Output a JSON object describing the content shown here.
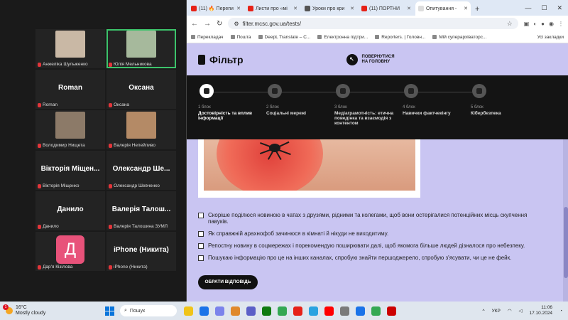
{
  "zoom": {
    "participants": [
      {
        "name": "Анжеліка Шульженко",
        "big": "",
        "photo": true,
        "photo_color": "#c9b8a5"
      },
      {
        "name": "Юлія Мельникова",
        "big": "",
        "photo": true,
        "photo_color": "#a6b99c",
        "active": true
      },
      {
        "name": "Roman",
        "big": "Roman"
      },
      {
        "name": "Оксана",
        "big": "Оксана"
      },
      {
        "name": "Володимир Нищета",
        "big": "",
        "photo": true,
        "photo_color": "#8c7a68"
      },
      {
        "name": "Валерія Непейпиво",
        "big": "",
        "photo": true,
        "photo_color": "#b48a66"
      },
      {
        "name": "Вікторія Міщенко",
        "big": "Вікторія Міщен..."
      },
      {
        "name": "Олександр Шевченко",
        "big": "Олександр Ше..."
      },
      {
        "name": "Данило",
        "big": "Данило"
      },
      {
        "name": "Валерія Талошина ЗУМЛ",
        "big": "Валерія Талош..."
      },
      {
        "name": "Дар'я Кізілова",
        "big": "",
        "avatar": "Д"
      },
      {
        "name": "iPhone (Никита)",
        "big": "iPhone (Никита)"
      }
    ]
  },
  "browser": {
    "tabs": [
      {
        "label": "(11) 🔥 Перепи",
        "color": "#e62117"
      },
      {
        "label": "Листи про «мі",
        "color": "#e62117"
      },
      {
        "label": "Уроки про кри",
        "color": "#555"
      },
      {
        "label": "(11) ПОРТНИ",
        "color": "#e62117"
      },
      {
        "label": "Опитування - ",
        "color": "#ddd",
        "current": true
      }
    ],
    "url": "filter.mcsc.gov.ua/tests/",
    "bookmarks": [
      "Перекладач",
      "Пошта",
      "DeepL Translate – С...",
      "Електронна підтри...",
      "Reporters. | Головн...",
      "Мій суперархіваторс..."
    ],
    "all_bookmarks": "Усі закладки"
  },
  "site": {
    "logo": "Фільтр",
    "back_label_1": "ПОВЕРНУТИСЯ",
    "back_label_2": "НА ГОЛОВНУ",
    "steps": [
      {
        "num": "1 блок",
        "title": "Достовірність та вплив інформації",
        "active": true
      },
      {
        "num": "2 блок",
        "title": "Соціальні мережі"
      },
      {
        "num": "3 блок",
        "title": "Медіаграмотність: етична поведінка та взаємодія з контентом"
      },
      {
        "num": "4 блок",
        "title": "Навички фактчекінгу"
      },
      {
        "num": "5 блок",
        "title": "Кібербезпека"
      }
    ],
    "options": [
      "Скоріше поділюся новиною в чатах з друзями, рідними та колегами, щоб вони остерігалися потенційних місць скупчення павуків.",
      "Як справжній арахнофоб зачинюся в кімнаті й нікуди не виходитиму.",
      "Репостну новину в соцмережах і порекомендую поширювати далі, щоб якомога більше людей дізналося про небезпеку.",
      "Пошукаю інформацію про це на інших каналах, спробую знайти першоджерело, спробую з'ясувати, чи це не фейк."
    ],
    "submit": "ОБРАТИ ВІДПОВІДЬ"
  },
  "taskbar": {
    "temp": "16°C",
    "weather": "Mostly cloudy",
    "notif": "1",
    "search": "Пошук",
    "lang": "УКР",
    "time": "11:06",
    "date": "17.10.2024",
    "apps": [
      "#f0c419",
      "#1b73e8",
      "#7b83eb",
      "#e0892b",
      "#5b5fc7",
      "#0f7b0f",
      "#34a853",
      "#e62117",
      "#2aa3e0",
      "#ff0000",
      "#7a7a7a",
      "#1a73e8",
      "#34a853",
      "#c00"
    ]
  }
}
